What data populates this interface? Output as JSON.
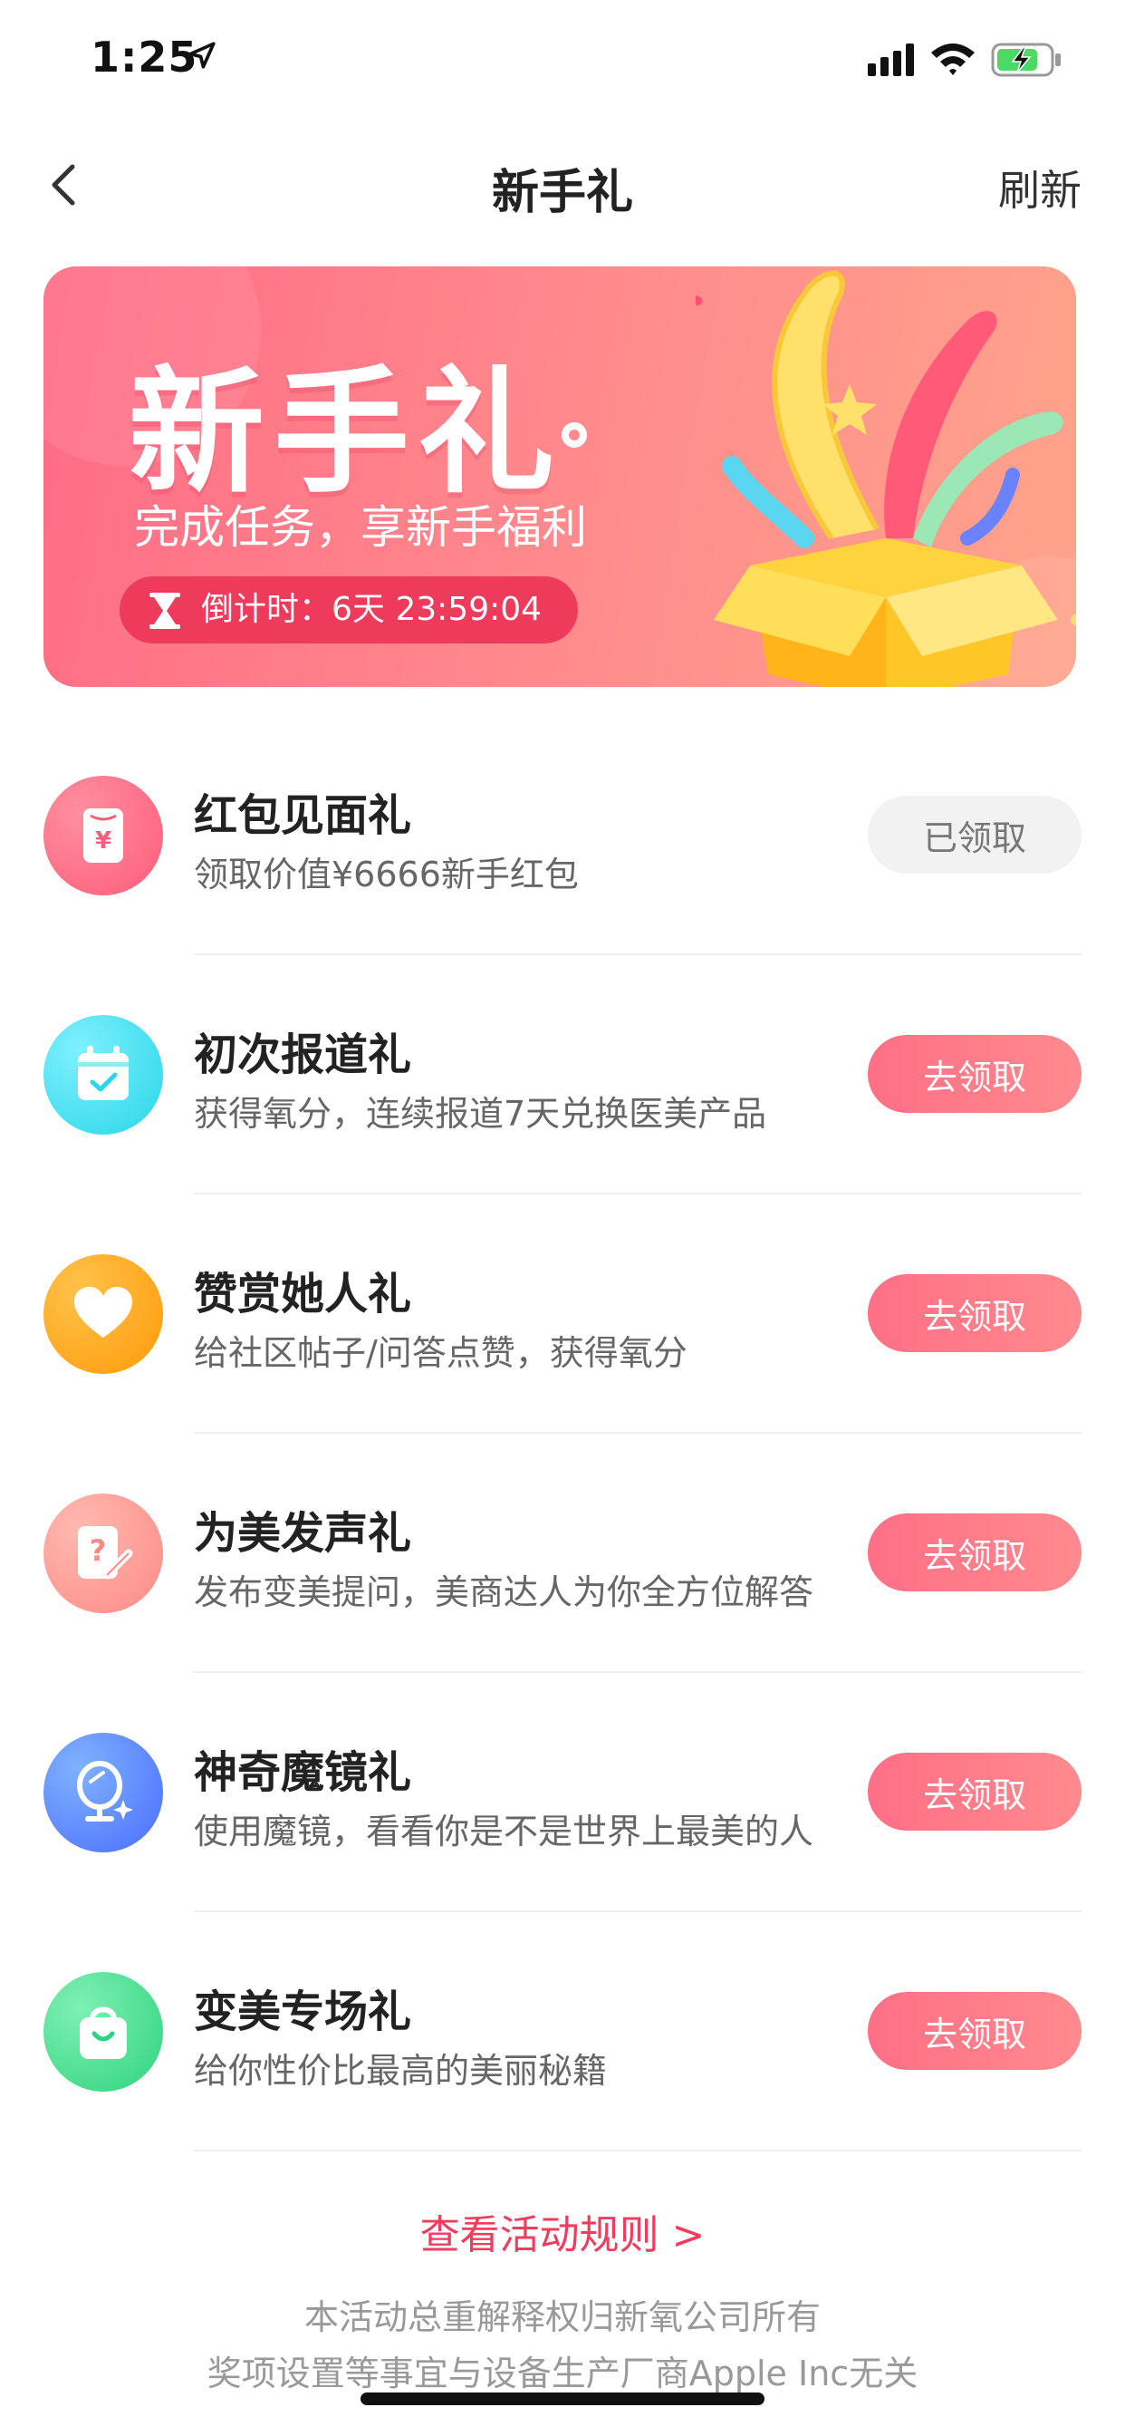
{
  "status": {
    "time": "1:25"
  },
  "nav": {
    "title": "新手礼",
    "refresh_label": "刷新"
  },
  "banner": {
    "title": "新手礼",
    "subtitle": "完成任务，享新手福利",
    "countdown_label": "倒计时：6天  23:59:04"
  },
  "gifts": [
    {
      "title": "红包见面礼",
      "desc": "领取价值¥6666新手红包",
      "button": "已领取",
      "claimed": true,
      "icon": "red-envelope-icon",
      "color": "#ff6f86"
    },
    {
      "title": "初次报道礼",
      "desc": "获得氧分，连续报道7天兑换医美产品",
      "button": "去领取",
      "claimed": false,
      "icon": "calendar-check-icon",
      "color": "#3ee0e8"
    },
    {
      "title": "赞赏她人礼",
      "desc": "给社区帖子/问答点赞，获得氧分",
      "button": "去领取",
      "claimed": false,
      "icon": "heart-icon",
      "color": "#ffa11a"
    },
    {
      "title": "为美发声礼",
      "desc": "发布变美提问，美商达人为你全方位解答",
      "button": "去领取",
      "claimed": false,
      "icon": "question-edit-icon",
      "color": "#ff9a92"
    },
    {
      "title": "神奇魔镜礼",
      "desc": "使用魔镜，看看你是不是世界上最美的人",
      "button": "去领取",
      "claimed": false,
      "icon": "magic-mirror-icon",
      "color": "#4f8dff"
    },
    {
      "title": "变美专场礼",
      "desc": "给你性价比最高的美丽秘籍",
      "button": "去领取",
      "claimed": false,
      "icon": "shopping-bag-icon",
      "color": "#3ed98a"
    }
  ],
  "footer": {
    "rules_link": "查看活动规则 >",
    "note_line1": "本活动总重解释权归新氧公司所有",
    "note_line2": "奖项设置等事宜与设备生产厂商Apple Inc无关"
  }
}
